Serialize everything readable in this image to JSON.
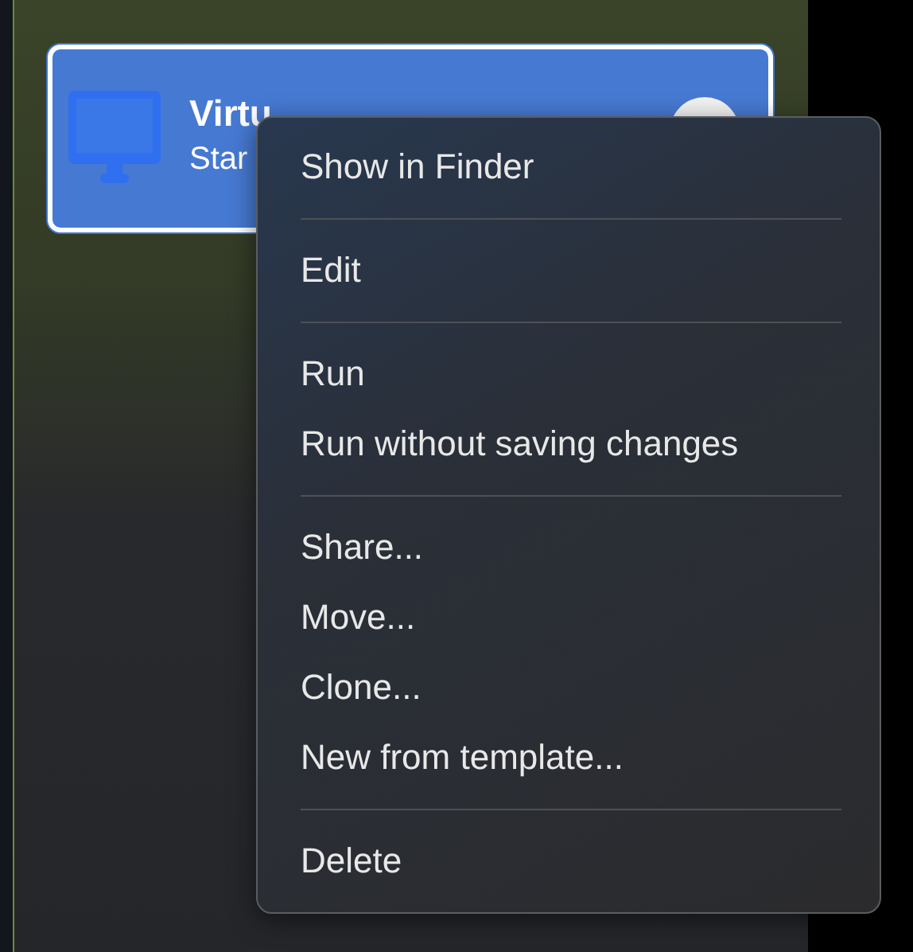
{
  "vm_card": {
    "title": "Virtu",
    "subtitle": "Star",
    "selected": true
  },
  "context_menu": {
    "sections": [
      [
        {
          "label": "Show in Finder"
        }
      ],
      [
        {
          "label": "Edit"
        }
      ],
      [
        {
          "label": "Run"
        },
        {
          "label": "Run without saving changes"
        }
      ],
      [
        {
          "label": "Share..."
        },
        {
          "label": "Move..."
        },
        {
          "label": "Clone..."
        },
        {
          "label": "New from template..."
        }
      ],
      [
        {
          "label": "Delete"
        }
      ]
    ]
  }
}
